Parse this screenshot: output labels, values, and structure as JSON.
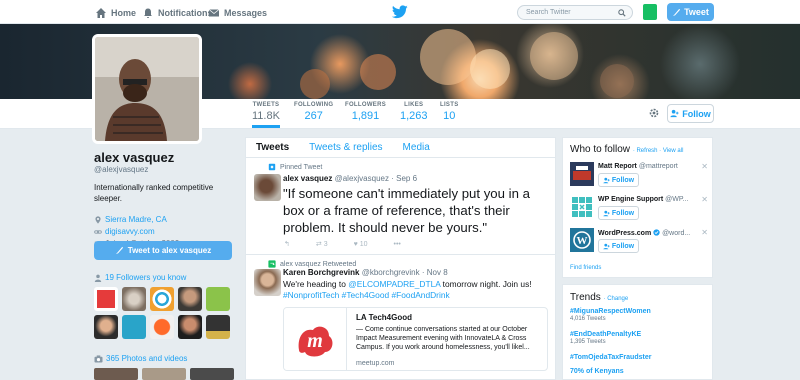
{
  "topnav": {
    "home_label": "Home",
    "notifications_label": "Notifications",
    "messages_label": "Messages",
    "search_placeholder": "Search Twitter",
    "tweet_button": "Tweet"
  },
  "profile_nav": {
    "stats": [
      {
        "label": "TWEETS",
        "value": "11.8K"
      },
      {
        "label": "FOLLOWING",
        "value": "267"
      },
      {
        "label": "FOLLOWERS",
        "value": "1,891"
      },
      {
        "label": "LIKES",
        "value": "1,263"
      },
      {
        "label": "LISTS",
        "value": "10"
      }
    ],
    "follow_label": "Follow"
  },
  "profile": {
    "name": "alex vasquez",
    "handle": "@alexjvasquez",
    "bio": "Internationally ranked competitive sleeper.",
    "location": "Sierra Madre, CA",
    "website": "digisavvy.com",
    "joined": "Joined October 2009",
    "tweet_to": "Tweet to alex vasquez",
    "followers_you_know": "19 Followers you know",
    "photos_videos": "365 Photos and videos"
  },
  "timeline": {
    "tabs": [
      "Tweets",
      "Tweets & replies",
      "Media"
    ],
    "tweets": [
      {
        "context": "Pinned Tweet",
        "name": "alex vasquez",
        "handle": "@alexjvasquez",
        "date": "· Sep 6",
        "text": "\"If someone can't immediately put you in a box or a frame of reference, that's their problem. It should never be yours.\"",
        "retweets": "3",
        "likes": "10"
      },
      {
        "context": "alex vasquez Retweeted",
        "name": "Karen Borchgrevink",
        "handle": "@kborchgrevink",
        "date": "· Nov 8",
        "text_before": "We're heading to ",
        "mention": "@ELCOMPADRE_DTLA",
        "text_after": " tomorrow night. Join us!",
        "hashtags": "#NonprofitTech #Tech4Good #FoodAndDrink",
        "card": {
          "title": "LA Tech4Good",
          "description": "— Come continue conversations started at our October Impact Measurement evening with InnovateLA & Cross Campus. If you work around homelessness, you'll likel...",
          "domain": "meetup.com"
        }
      }
    ]
  },
  "who_to_follow": {
    "title": "Who to follow",
    "refresh": "· Refresh",
    "view_all": "· View all",
    "follow_label": "Follow",
    "suggestions": [
      {
        "name": "Matt Report",
        "handle": "@mattreport",
        "color": "#2b3a5c"
      },
      {
        "name": "WP Engine Support",
        "handle": "@WP...",
        "color": "#40bfbf"
      },
      {
        "name": "WordPress.com",
        "handle": "@word...",
        "color": "#21759b"
      }
    ],
    "find_friends": "Find friends"
  },
  "trends": {
    "title": "Trends",
    "change": "· Change",
    "items": [
      {
        "tag": "#MigunaRespectWomen",
        "count": "4,016 Tweets"
      },
      {
        "tag": "#EndDeathPenaltyKE",
        "count": "1,395 Tweets"
      },
      {
        "tag": "#TomOjedaTaxFraudster",
        "count": ""
      },
      {
        "tag": "70% of Kenyans",
        "count": ""
      }
    ]
  },
  "colors": {
    "accent": "#1da1f2",
    "button_blue": "#55acee",
    "meetup_red": "#e0393e"
  }
}
